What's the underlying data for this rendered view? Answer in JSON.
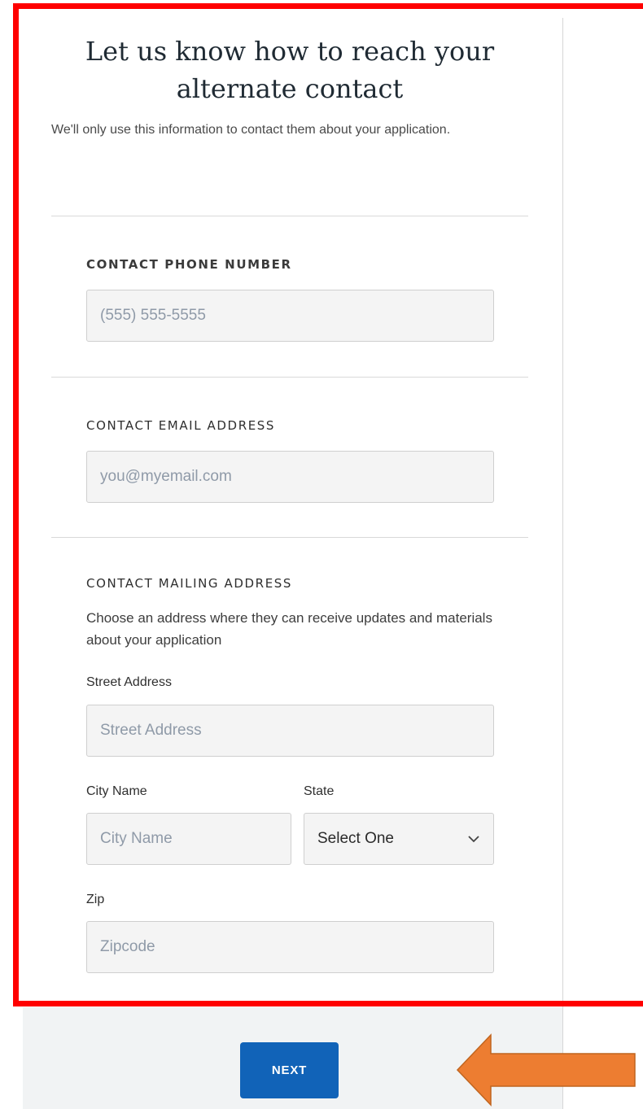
{
  "page": {
    "title": "Let us know how to reach your alternate contact",
    "subtitle": "We'll only use this information to contact them about your application."
  },
  "phone": {
    "label": "CONTACT PHONE NUMBER",
    "placeholder": "(555) 555-5555",
    "value": ""
  },
  "email": {
    "label": "CONTACT EMAIL ADDRESS",
    "placeholder": "you@myemail.com",
    "value": ""
  },
  "mailing": {
    "label": "CONTACT MAILING ADDRESS",
    "helper": "Choose an address where they can receive updates and materials about your application",
    "street": {
      "label": "Street Address",
      "placeholder": "Street Address",
      "value": ""
    },
    "city": {
      "label": "City Name",
      "placeholder": "City Name",
      "value": ""
    },
    "state": {
      "label": "State",
      "selected": "Select One"
    },
    "zip": {
      "label": "Zip",
      "placeholder": "Zipcode",
      "value": ""
    }
  },
  "footer": {
    "next_label": "NEXT"
  },
  "annotations": {
    "highlight_color": "#ff0000",
    "arrow_color": "#ed7d31",
    "arrow_icon": "left-arrow-icon"
  },
  "colors": {
    "primary_button": "#1163b8",
    "footer_bg": "#f1f3f4"
  }
}
